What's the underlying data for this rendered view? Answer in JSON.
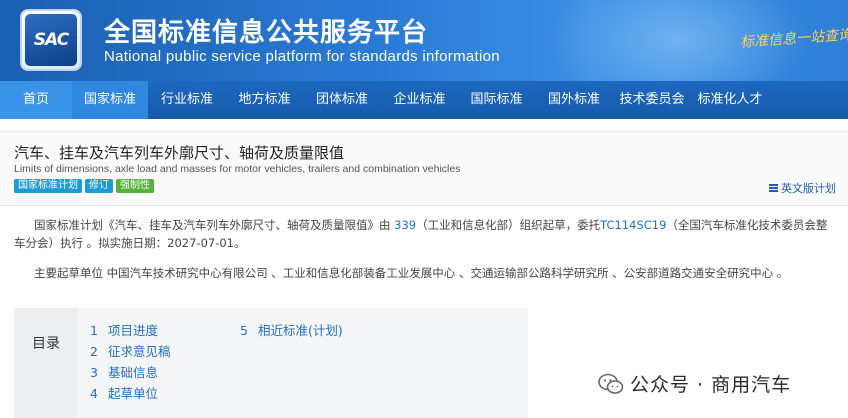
{
  "header": {
    "logo_text": "SAC",
    "title": "全国标准信息公共服务平台",
    "subtitle": "National public service platform  for standards information",
    "slogan": "标准信息一站查询"
  },
  "nav": {
    "items": [
      {
        "label": "首页"
      },
      {
        "label": "国家标准"
      },
      {
        "label": "行业标准"
      },
      {
        "label": "地方标准"
      },
      {
        "label": "团体标准"
      },
      {
        "label": "企业标准"
      },
      {
        "label": "国际标准"
      },
      {
        "label": "国外标准"
      },
      {
        "label": "技术委员会"
      },
      {
        "label": "标准化人才"
      }
    ]
  },
  "standard": {
    "title_cn": "汽车、挂车及汽车列车外廓尺寸、轴荷及质量限值",
    "title_en": "Limits of dimensions, axle load and masses for motor vehicles, trailers and combination vehicles",
    "tags": [
      "国家标准计划",
      "修订",
      "强制性"
    ],
    "en_plan_label": "英文版计划"
  },
  "description": {
    "part1": "国家标准计划《汽车、挂车及汽车列车外廓尺寸、轴荷及质量限值》由 ",
    "org_code": "339",
    "part2": "（工业和信息化部）组织起草，委托",
    "tc_code": "TC114SC19",
    "part3": "（全国汽车标准化技术委员会整车分会）执行 。拟实施日期：2027-07-01。",
    "orgs_line": "主要起草单位 中国汽车技术研究中心有限公司 、工业和信息化部装备工业发展中心 、交通运输部公路科学研究所 、公安部道路交通安全研究中心 。"
  },
  "toc": {
    "label": "目录",
    "col1": [
      {
        "num": "1",
        "text": "项目进度"
      },
      {
        "num": "2",
        "text": "征求意见稿"
      },
      {
        "num": "3",
        "text": "基础信息"
      },
      {
        "num": "4",
        "text": "起草单位"
      }
    ],
    "col2": [
      {
        "num": "5",
        "text": "相近标准(计划)"
      }
    ]
  },
  "watermark": {
    "text": "公众号 · 商用汽车"
  },
  "colors": {
    "banner": "#2a7bd6",
    "nav": "#1659a9",
    "nav_active": "#2f87e0",
    "link": "#1f6fc4",
    "tag_blue": "#1e9bd7",
    "tag_green": "#55b33c"
  }
}
